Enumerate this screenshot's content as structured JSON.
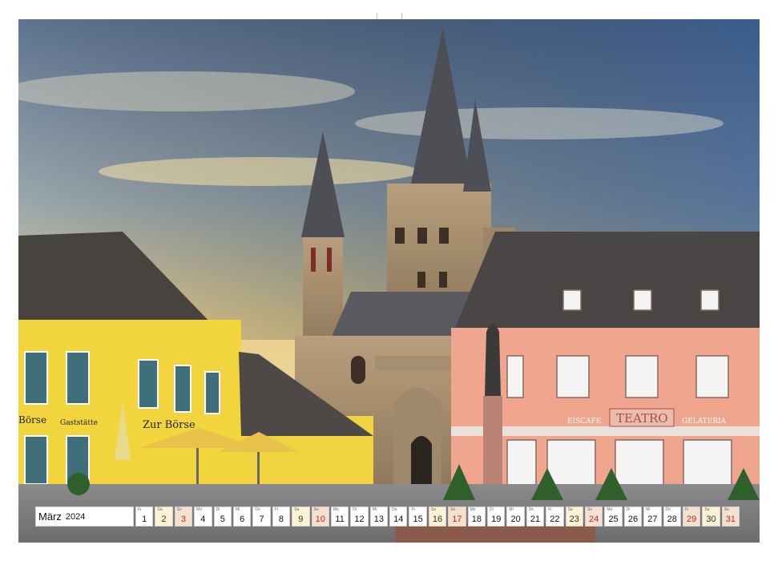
{
  "calendar": {
    "month": "März",
    "year": "2024",
    "days": [
      {
        "wd": "Fr",
        "d": "1",
        "t": "wd"
      },
      {
        "wd": "Sa",
        "d": "2",
        "t": "we"
      },
      {
        "wd": "So",
        "d": "3",
        "t": "su"
      },
      {
        "wd": "Mo",
        "d": "4",
        "t": "wd"
      },
      {
        "wd": "Di",
        "d": "5",
        "t": "wd"
      },
      {
        "wd": "Mi",
        "d": "6",
        "t": "wd"
      },
      {
        "wd": "Do",
        "d": "7",
        "t": "wd"
      },
      {
        "wd": "Fr",
        "d": "8",
        "t": "wd"
      },
      {
        "wd": "Sa",
        "d": "9",
        "t": "we"
      },
      {
        "wd": "So",
        "d": "10",
        "t": "su"
      },
      {
        "wd": "Mo",
        "d": "11",
        "t": "wd"
      },
      {
        "wd": "Di",
        "d": "12",
        "t": "wd"
      },
      {
        "wd": "Mi",
        "d": "13",
        "t": "wd"
      },
      {
        "wd": "Do",
        "d": "14",
        "t": "wd"
      },
      {
        "wd": "Fr",
        "d": "15",
        "t": "wd"
      },
      {
        "wd": "Sa",
        "d": "16",
        "t": "we"
      },
      {
        "wd": "So",
        "d": "17",
        "t": "su"
      },
      {
        "wd": "Mo",
        "d": "18",
        "t": "wd"
      },
      {
        "wd": "Di",
        "d": "19",
        "t": "wd"
      },
      {
        "wd": "Mi",
        "d": "20",
        "t": "wd"
      },
      {
        "wd": "Do",
        "d": "21",
        "t": "wd"
      },
      {
        "wd": "Fr",
        "d": "22",
        "t": "wd"
      },
      {
        "wd": "Sa",
        "d": "23",
        "t": "we"
      },
      {
        "wd": "So",
        "d": "24",
        "t": "su"
      },
      {
        "wd": "Mo",
        "d": "25",
        "t": "wd"
      },
      {
        "wd": "Di",
        "d": "26",
        "t": "wd"
      },
      {
        "wd": "Mi",
        "d": "27",
        "t": "wd"
      },
      {
        "wd": "Do",
        "d": "28",
        "t": "wd"
      },
      {
        "wd": "Fr",
        "d": "29",
        "t": "su"
      },
      {
        "wd": "Sa",
        "d": "30",
        "t": "we"
      },
      {
        "wd": "So",
        "d": "31",
        "t": "su"
      }
    ]
  },
  "signs": {
    "left_building": "Zur Börse",
    "left_edge": "Börse",
    "gaststaette": "Gaststätte",
    "cafe": "EISCAFE",
    "teatro": "TEATRO",
    "gelateria": "GELATERIA"
  },
  "colors": {
    "yellow_facade": "#f2d53c",
    "pink_facade": "#efa58e",
    "sunday_red": "#c0282a",
    "weekend_fill": "#fdf3d2"
  }
}
